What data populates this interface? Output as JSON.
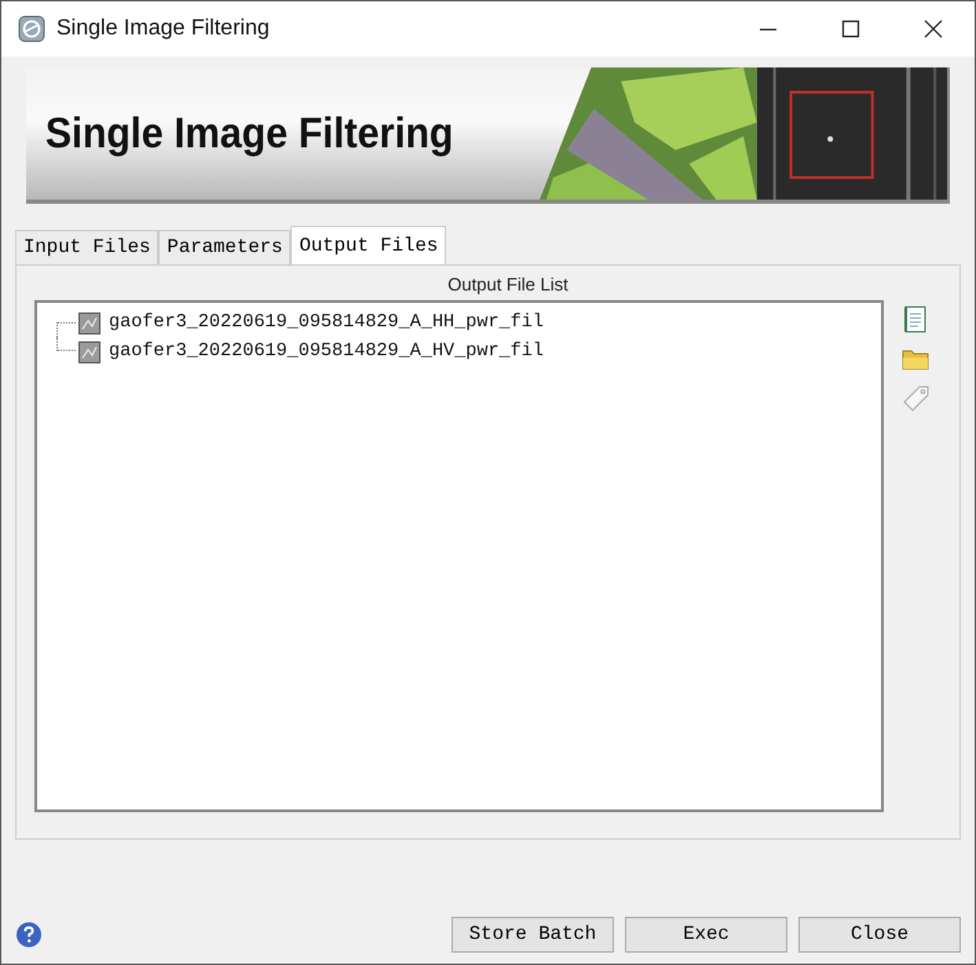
{
  "window": {
    "title": "Single Image Filtering"
  },
  "banner": {
    "title": "Single Image Filtering",
    "kind": "picture"
  },
  "tabs": [
    {
      "label": "Input Files",
      "selected": false
    },
    {
      "label": "Parameters",
      "selected": false
    },
    {
      "label": "Output Files",
      "selected": true
    }
  ],
  "output_list": {
    "title": "Output File List",
    "items": [
      {
        "name": "gaofer3_20220619_095814829_A_HH_pwr_fil"
      },
      {
        "name": "gaofer3_20220619_095814829_A_HV_pwr_fil"
      }
    ]
  },
  "tools": [
    {
      "kind": "document",
      "disabled": false
    },
    {
      "kind": "folder",
      "disabled": false
    },
    {
      "kind": "tag",
      "disabled": true
    }
  ],
  "buttons": [
    "Store Batch",
    "Exec",
    "Close"
  ]
}
